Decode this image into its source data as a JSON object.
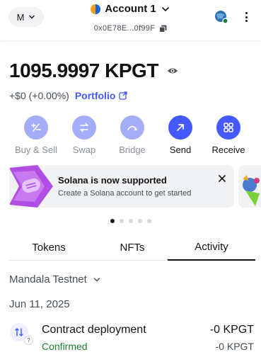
{
  "header": {
    "network_initial": "M",
    "account_name": "Account 1",
    "address": "0x0E78E...0f99F"
  },
  "balance": {
    "value": "1095.9997 KPGT",
    "fiat_change": "+$0 (+0.00%)",
    "portfolio_label": "Portfolio"
  },
  "actions": [
    {
      "label": "Buy & Sell",
      "enabled": false,
      "icon": "plus-minus-icon"
    },
    {
      "label": "Swap",
      "enabled": false,
      "icon": "swap-arrows-icon"
    },
    {
      "label": "Bridge",
      "enabled": false,
      "icon": "bridge-icon"
    },
    {
      "label": "Send",
      "enabled": true,
      "icon": "arrow-up-right-icon"
    },
    {
      "label": "Receive",
      "enabled": true,
      "icon": "qr-code-icon"
    }
  ],
  "banner": {
    "title": "Solana is now supported",
    "subtitle": "Create a Solana account to get started"
  },
  "carousel": {
    "count": 5,
    "active_index": 0
  },
  "tabs": [
    "Tokens",
    "NFTs",
    "Activity"
  ],
  "active_tab": "Activity",
  "network_filter": "Mandala Testnet",
  "activity": {
    "date": "Jun 11, 2025",
    "items": [
      {
        "title": "Contract deployment",
        "status": "Confirmed",
        "amount": "-0 KPGT",
        "amount_secondary": "-0 KPGT"
      }
    ]
  },
  "colors": {
    "accent": "#4459ff",
    "accent_disabled": "#a4adf7",
    "success": "#1c7e33",
    "banner_bg": "#f1f2f4"
  }
}
